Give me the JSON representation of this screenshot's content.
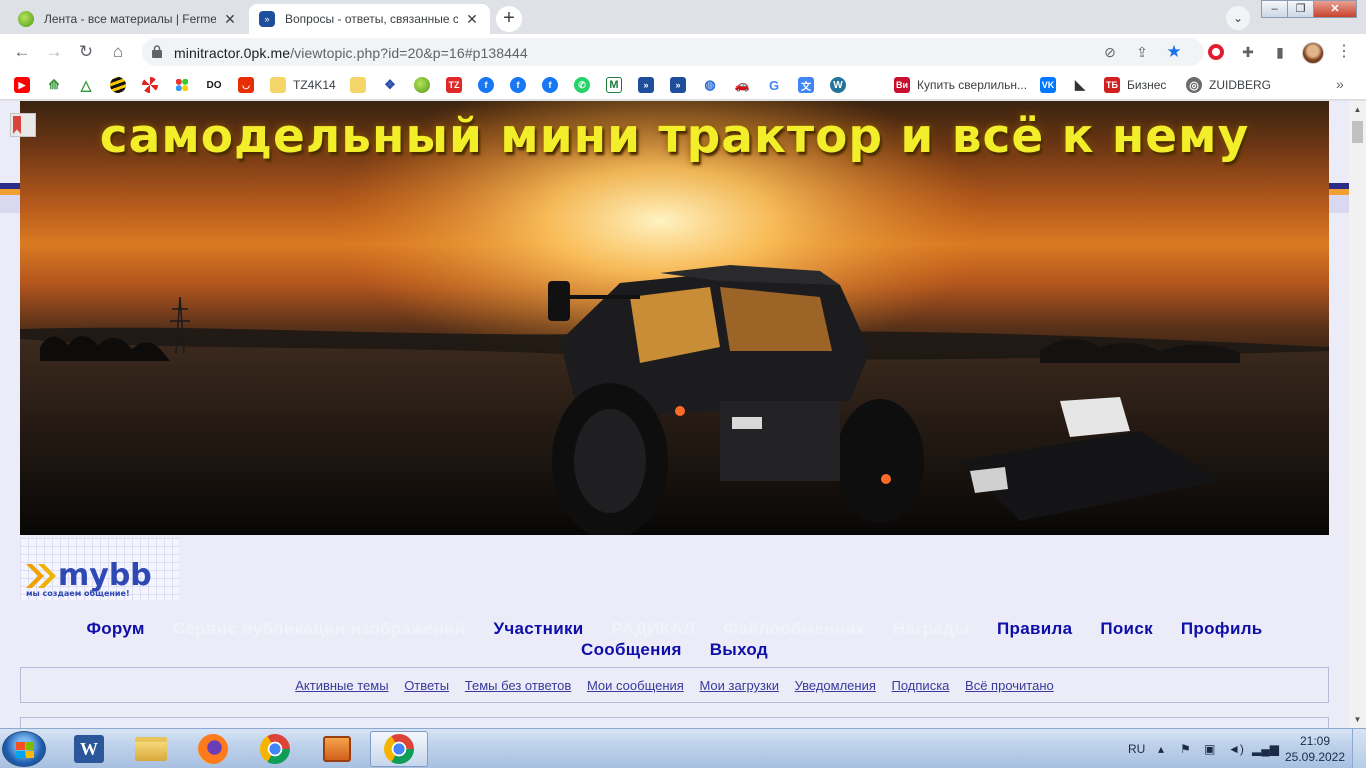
{
  "browser": {
    "tabs": [
      {
        "title": "Лента - все материалы | Fermer",
        "active": false
      },
      {
        "title": "Вопросы - ответы, связанные с",
        "active": true
      }
    ],
    "url_host": "minitractor.0pk.me",
    "url_path": "/viewtopic.php?id=20&p=16#p138444",
    "bookmarks": [
      {
        "label": "TZ4K14"
      },
      {
        "label": "Купить сверлильн..."
      },
      {
        "label": "Бизнес"
      },
      {
        "label": "ZUIDBERG"
      }
    ]
  },
  "page": {
    "banner_title": "самодельный мини трактор и всё к нему",
    "logo_text": "mybb",
    "logo_tagline": "мы создаем общение!",
    "nav": [
      {
        "label": "Форум",
        "faded": false
      },
      {
        "label": "Сервис публикации изображений",
        "faded": true
      },
      {
        "label": "Участники",
        "faded": false
      },
      {
        "label": "РАДИКАЛ",
        "faded": true
      },
      {
        "label": "Файлообменник",
        "faded": true
      },
      {
        "label": "Награды",
        "faded": true
      },
      {
        "label": "Правила",
        "faded": false
      },
      {
        "label": "Поиск",
        "faded": false
      },
      {
        "label": "Профиль",
        "faded": false
      },
      {
        "label": "Сообщения",
        "faded": false
      },
      {
        "label": "Выход",
        "faded": false
      }
    ],
    "subnav": [
      "Активные темы",
      "Ответы",
      "Темы без ответов",
      "Мои сообщения",
      "Мои загрузки",
      "Уведомления",
      "Подписка",
      "Всё прочитано"
    ]
  },
  "taskbar": {
    "language": "RU",
    "time": "21:09",
    "date": "25.09.2022"
  },
  "colors": {
    "nav_link": "#0e0ea8",
    "nav_link_faded": "#f2f2fb",
    "subnav_link": "#3a3a9c",
    "page_bg": "#ececf8",
    "banner_title": "#f2ee2a"
  }
}
